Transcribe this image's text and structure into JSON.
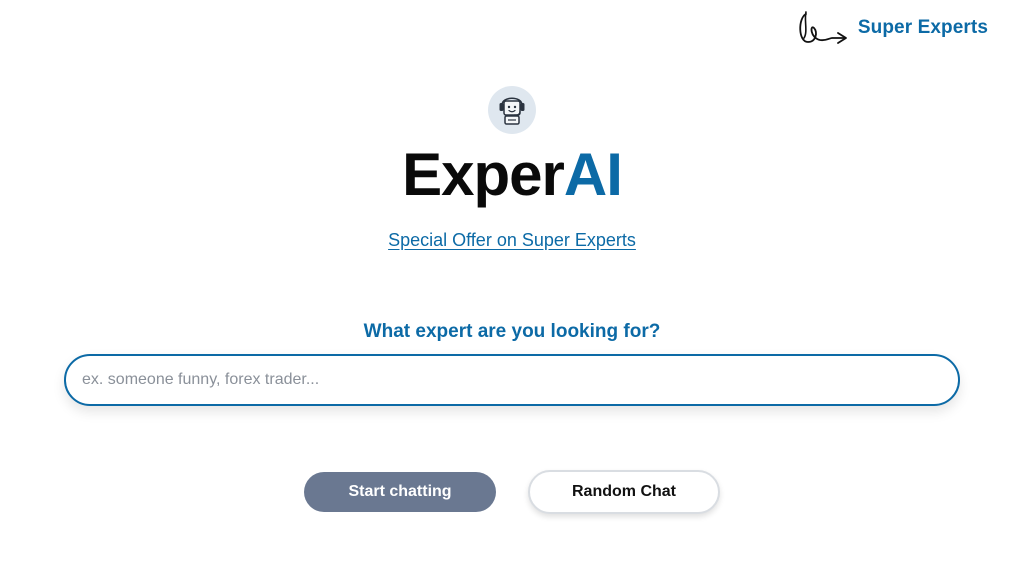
{
  "header": {
    "brand_label": "Super Experts",
    "brand_icon": "scribble-arrow-logo-icon"
  },
  "hero": {
    "avatar_icon": "robot-headset-icon",
    "title_part1": "Exper",
    "title_part2": "AI",
    "offer_link": "Special Offer on Super Experts"
  },
  "search": {
    "question": "What expert are you looking for?",
    "value": "",
    "placeholder": "ex. someone funny, forex trader..."
  },
  "actions": {
    "start_label": "Start chatting",
    "random_label": "Random Chat"
  },
  "colors": {
    "accent": "#0c6aa6",
    "start_button_bg": "#6a7891",
    "avatar_bg": "#dfe7ef"
  }
}
